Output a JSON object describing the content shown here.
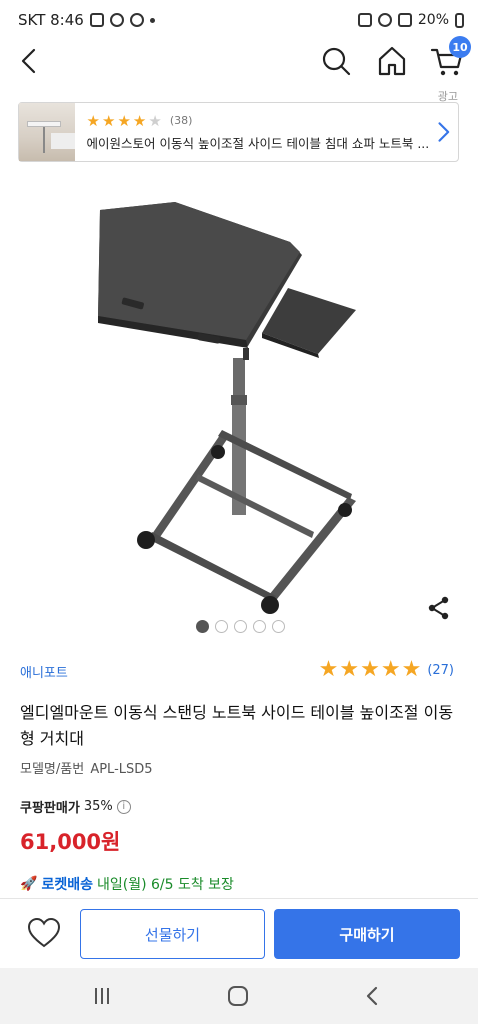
{
  "status_bar": {
    "carrier_time": "SKT 8:46",
    "battery": "20%"
  },
  "nav": {
    "cart_count": "10"
  },
  "ad": {
    "label": "광고",
    "rating_count": "(38)",
    "title": "에이원스토어 이동식 높이조절 사이드 테이블 침대 쇼파 노트북 ..."
  },
  "product": {
    "brand": "애니포트",
    "rating_count": "(27)",
    "title": "엘디엘마운트 이동식 스탠딩 노트북 사이드 테이블 높이조절 이동형 거치대",
    "model_label": "모델명/품번",
    "model_value": "APL-LSD5",
    "price_label": "쿠팡판매가",
    "discount": "35%",
    "price": "61,000원",
    "rocket_label": "로켓배송",
    "rocket_info": "내일(월) 6/5 도착 보장",
    "image_index": 1,
    "image_total": 5
  },
  "actions": {
    "gift": "선물하기",
    "buy": "구매하기"
  },
  "colors": {
    "accent": "#3574e8",
    "price": "#d8232a",
    "star": "#f5a623",
    "rocket": "#0a64d6"
  }
}
